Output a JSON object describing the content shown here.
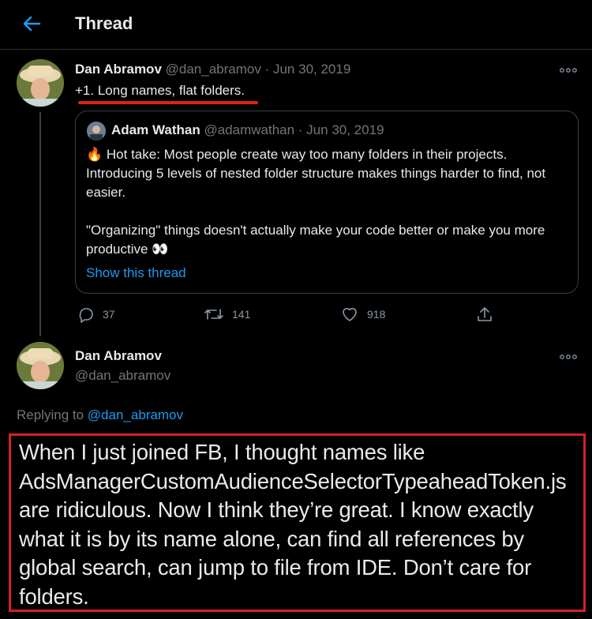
{
  "header": {
    "title": "Thread"
  },
  "tweet1": {
    "name": "Dan Abramov",
    "handle": "@dan_abramov",
    "date": "· Jun 30, 2019",
    "text": "+1. Long names, flat folders.",
    "quote": {
      "name": "Adam Wathan",
      "handle": "@adamwathan",
      "date": "· Jun 30, 2019",
      "fire_emoji": "🔥",
      "line1": "Hot take: Most people create way too many folders in their projects. Introducing 5 levels of nested folder structure makes things harder to find, not easier.",
      "line2": "\"Organizing\" things doesn't actually make your code better or make you more productive",
      "eyes_emoji": "👀",
      "show_thread": "Show this thread"
    },
    "actions": {
      "replies": "37",
      "retweets": "141",
      "likes": "918"
    }
  },
  "tweet2": {
    "name": "Dan Abramov",
    "handle": "@dan_abramov",
    "replying_label": "Replying to",
    "replying_to": "@dan_abramov",
    "text": "When I just joined FB, I thought names like AdsManagerCustomAudienceSelectorTypeaheadToken.js are ridiculous. Now I think they’re great. I know exactly what it is by its name alone, can find all references by global search, can jump to file from IDE. Don’t care for folders."
  },
  "colors": {
    "accent": "#1d9bf0",
    "highlight": "#d4202a",
    "background": "#000000"
  },
  "icons": [
    "back-arrow-icon",
    "more-icon",
    "reply-icon",
    "retweet-icon",
    "like-icon",
    "share-icon"
  ]
}
